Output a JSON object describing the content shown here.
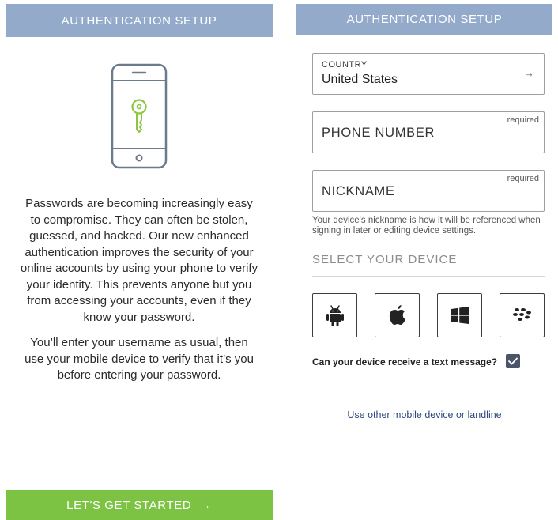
{
  "left": {
    "header_title": "AUTHENTICATION SETUP",
    "intro_paragraph_1": "Passwords are becoming increasingly easy to compromise. They can often be stolen, guessed, and hacked. Our new enhanced authentication improves the security of your online accounts by using your phone to verify your identity. This prevents anyone but you from accessing your accounts, even if they know your password.",
    "intro_paragraph_2": "You’ll enter your username as usual, then use your mobile device to verify that it’s you before entering your password.",
    "cta_label": "LET'S GET STARTED",
    "cta_arrow": "→",
    "illustration_icon": "phone-with-key-icon"
  },
  "right": {
    "header_title": "AUTHENTICATION SETUP",
    "country": {
      "label": "COUNTRY",
      "value": "United States",
      "arrow": "→"
    },
    "phone_number": {
      "label": "PHONE NUMBER",
      "required": "required"
    },
    "nickname": {
      "label": "NICKNAME",
      "required": "required",
      "helper": "Your device's nickname is how it will be referenced when signing in later or editing device settings."
    },
    "select_device_title": "SELECT YOUR DEVICE",
    "devices": [
      "android-icon",
      "apple-icon",
      "windows-icon",
      "blackberry-icon"
    ],
    "text_message_question": "Can your device receive a text message?",
    "text_message_checked": true,
    "alt_link": "Use other mobile device or landline"
  },
  "colors": {
    "header": "#93aacb",
    "cta": "#7cc243",
    "key_accent": "#8cc63f",
    "checkbox": "#4a5568",
    "link": "#2d4a7d"
  }
}
